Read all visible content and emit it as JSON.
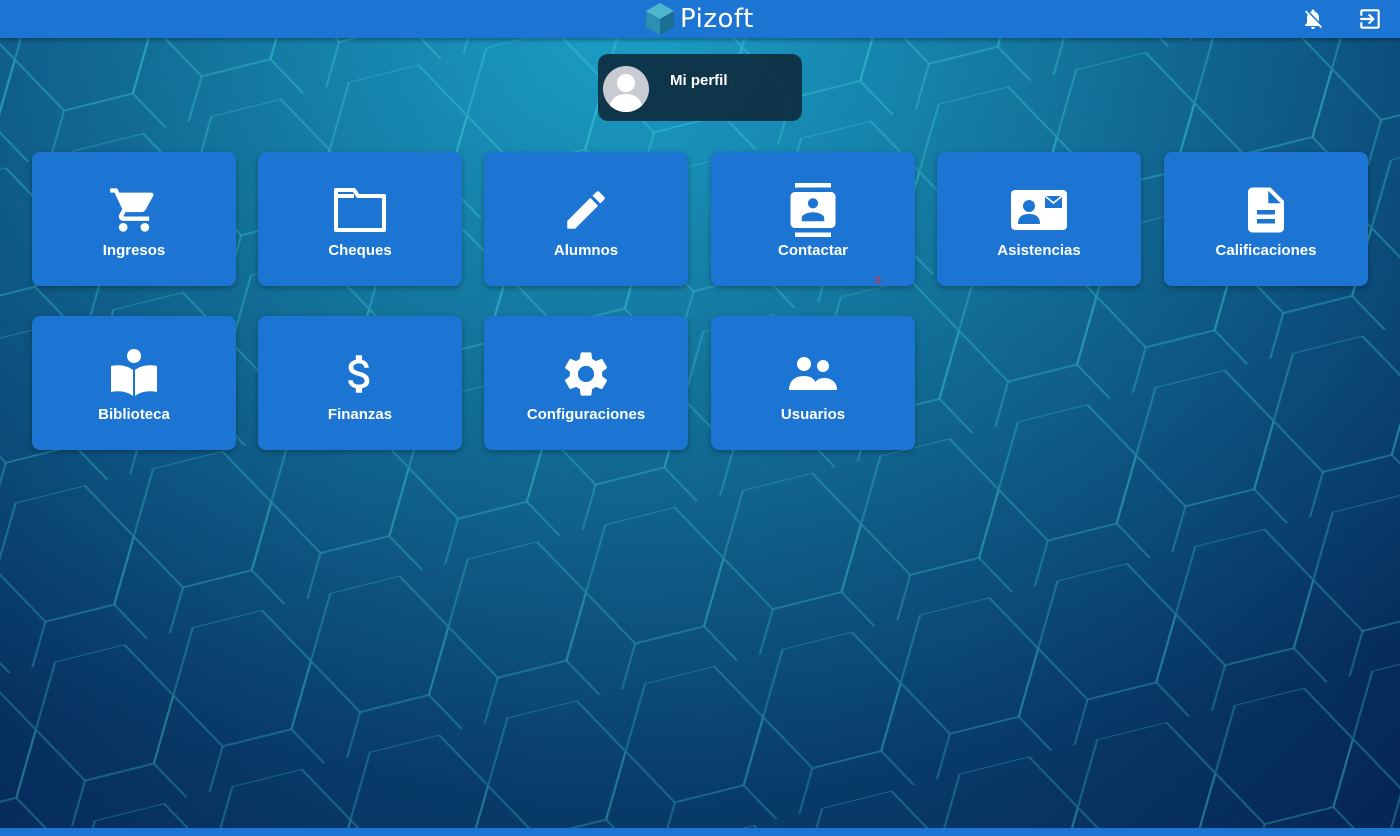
{
  "header": {
    "app_name": "Pizoft",
    "logo_icon": "hexagon-logo-icon",
    "notifications_icon": "bell-off-icon",
    "logout_icon": "exit-to-app-icon",
    "color": "#1c75d2"
  },
  "profile": {
    "label": "Mi perfil",
    "avatar_icon": "user-silhouette-icon"
  },
  "tiles": [
    {
      "label": "Ingresos",
      "icon": "cart-icon"
    },
    {
      "label": "Cheques",
      "icon": "folder-icon"
    },
    {
      "label": "Alumnos",
      "icon": "pencil-icon"
    },
    {
      "label": "Contactar",
      "icon": "contacts-icon"
    },
    {
      "label": "Asistencias",
      "icon": "id-card-icon"
    },
    {
      "label": "Calificaciones",
      "icon": "document-icon"
    },
    {
      "label": "Biblioteca",
      "icon": "reader-book-icon"
    },
    {
      "label": "Finanzas",
      "icon": "dollar-icon"
    },
    {
      "label": "Configuraciones",
      "icon": "gear-icon"
    },
    {
      "label": "Usuarios",
      "icon": "people-icon"
    }
  ],
  "contact_badge": "8",
  "colors": {
    "tile": "#1c75d2",
    "badge": "#e0303c"
  }
}
